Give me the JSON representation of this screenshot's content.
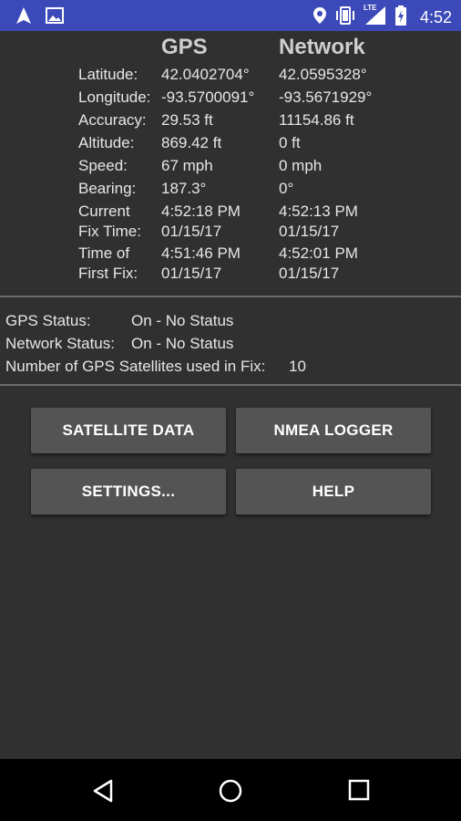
{
  "status_bar": {
    "time": "4:52",
    "lte_label": "LTE",
    "icons": [
      "navigation-arrow-icon",
      "image-icon",
      "location-pin-icon",
      "vibrate-icon",
      "signal-icon",
      "battery-charging-icon"
    ]
  },
  "headers": {
    "gps": "GPS",
    "network": "Network"
  },
  "rows": [
    {
      "label": "Latitude:",
      "gps": "42.0402704°",
      "network": "42.0595328°"
    },
    {
      "label": "Longitude:",
      "gps": "-93.5700091°",
      "network": "-93.5671929°"
    },
    {
      "label": "Accuracy:",
      "gps": "29.53 ft",
      "network": "11154.86 ft"
    },
    {
      "label": "Altitude:",
      "gps": "869.42 ft",
      "network": "0 ft"
    },
    {
      "label": "Speed:",
      "gps": "67 mph",
      "network": "0 mph"
    },
    {
      "label": "Bearing:",
      "gps": "187.3°",
      "network": "0°"
    }
  ],
  "fix_time": {
    "label_line1": "Current",
    "label_line2": "Fix Time:",
    "gps_time": "4:52:18 PM",
    "gps_date": "01/15/17",
    "net_time": "4:52:13 PM",
    "net_date": "01/15/17"
  },
  "first_fix": {
    "label_line1": "Time of",
    "label_line2": "First Fix:",
    "gps_time": "4:51:46 PM",
    "gps_date": "01/15/17",
    "net_time": "4:52:01 PM",
    "net_date": "01/15/17"
  },
  "status": {
    "gps_label": "GPS Status:",
    "gps_value": "On - No Status",
    "network_label": "Network Status:",
    "network_value": "On - No Status",
    "satellites_label": "Number of GPS Satellites used in Fix:",
    "satellites_value": "10"
  },
  "buttons": {
    "satellite_data": "SATELLITE DATA",
    "nmea_logger": "NMEA LOGGER",
    "settings": "SETTINGS...",
    "help": "HELP"
  },
  "colors": {
    "status_bar": "#3c49b9",
    "background": "#303030",
    "button": "#545454"
  }
}
